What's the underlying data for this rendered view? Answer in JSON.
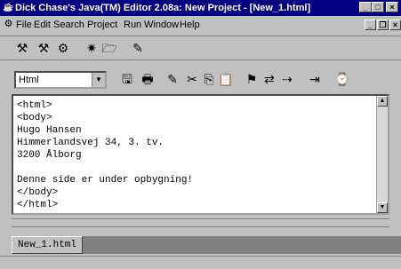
{
  "window": {
    "title": "Dick Chase's Java(TM) Editor 2.08a: New Project - [New_1.html]",
    "app_icon": "java-editor-icon",
    "controls": {
      "minimize": "_",
      "maximize": "□",
      "close": "×"
    }
  },
  "menu": {
    "items": [
      "File",
      "Edit",
      "Search",
      "Project",
      "Run",
      "Window",
      "Help"
    ],
    "mdi_controls": {
      "minimize": "_",
      "restore": "❐",
      "close": "×"
    }
  },
  "toolbar_top": {
    "buttons": [
      {
        "name": "compile-icon",
        "glyph": "⚒"
      },
      {
        "name": "compile-all-icon",
        "glyph": "⚒"
      },
      {
        "name": "build-icon",
        "glyph": "⚙"
      },
      {
        "name": "new-project-icon",
        "glyph": "✷"
      },
      {
        "name": "open-project-icon",
        "glyph": "🗁"
      },
      {
        "name": "wizard-icon",
        "glyph": "✎"
      }
    ]
  },
  "toolbar_edit": {
    "language_select": {
      "value": "Html"
    },
    "buttons": [
      {
        "name": "save-icon",
        "glyph": "🖫"
      },
      {
        "name": "print-icon",
        "glyph": "🖶"
      },
      {
        "name": "pencil-icon",
        "glyph": "✎"
      },
      {
        "name": "cut-icon",
        "glyph": "✂"
      },
      {
        "name": "copy-icon",
        "glyph": "⎘"
      },
      {
        "name": "paste-icon",
        "glyph": "📋"
      },
      {
        "name": "find-icon",
        "glyph": "⚑"
      },
      {
        "name": "replace-icon",
        "glyph": "⇄"
      },
      {
        "name": "goto-icon",
        "glyph": "⇢"
      },
      {
        "name": "indent-icon",
        "glyph": "⇥"
      },
      {
        "name": "help-icon",
        "glyph": "⌚"
      }
    ]
  },
  "editor": {
    "content": "<html>\n<body>\nHugo Hansen\nHimmerlandsvej 34, 3. tv.\n3200 Ålborg\n\nDenne side er under opbygning!\n</body>\n</html>"
  },
  "tabs": [
    {
      "label": "New_1.html",
      "active": true
    }
  ]
}
